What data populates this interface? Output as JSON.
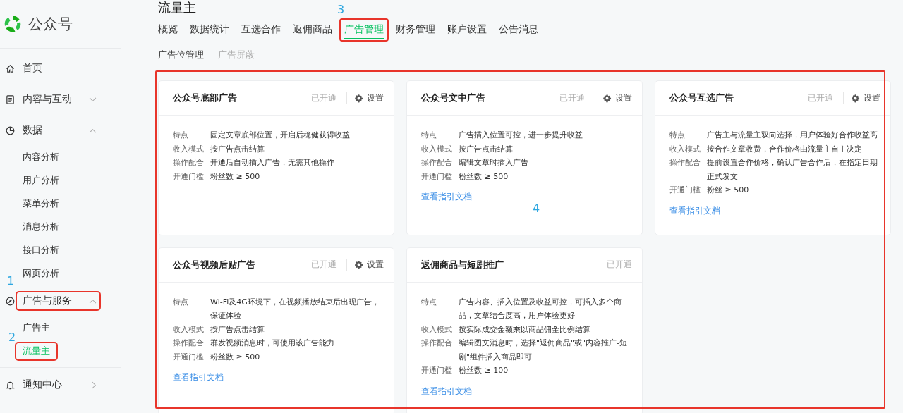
{
  "logo": {
    "text": "公众号"
  },
  "sidebar": {
    "items": [
      {
        "label": "首页",
        "kind": "plain"
      },
      {
        "label": "内容与互动",
        "kind": "group",
        "expanded": false
      },
      {
        "label": "数据",
        "kind": "group",
        "expanded": true,
        "children": [
          {
            "label": "内容分析",
            "selected": false
          },
          {
            "label": "用户分析",
            "selected": false
          },
          {
            "label": "菜单分析",
            "selected": false
          },
          {
            "label": "消息分析",
            "selected": false
          },
          {
            "label": "接口分析",
            "selected": false
          },
          {
            "label": "网页分析",
            "selected": false
          }
        ]
      },
      {
        "label": "广告与服务",
        "kind": "group",
        "expanded": true,
        "highlighted": true,
        "marker": "1",
        "children": [
          {
            "label": "广告主",
            "selected": false
          },
          {
            "label": "流量主",
            "selected": true,
            "highlighted": true,
            "marker": "2"
          }
        ]
      },
      {
        "label": "通知中心",
        "kind": "link"
      }
    ]
  },
  "page_title": "流量主",
  "tabs": [
    {
      "label": "概览",
      "selected": false
    },
    {
      "label": "数据统计",
      "selected": false
    },
    {
      "label": "互选合作",
      "selected": false
    },
    {
      "label": "返佣商品",
      "selected": false
    },
    {
      "label": "广告管理",
      "selected": true,
      "highlighted": true,
      "marker": "3"
    },
    {
      "label": "财务管理",
      "selected": false
    },
    {
      "label": "账户设置",
      "selected": false
    },
    {
      "label": "公告消息",
      "selected": false
    }
  ],
  "subtabs": [
    {
      "label": "广告位管理",
      "selected": true
    },
    {
      "label": "广告屏蔽",
      "selected": false
    }
  ],
  "ad_grid": {
    "highlighted": true,
    "marker": "4",
    "cards": [
      {
        "title": "公众号底部广告",
        "status": "已开通",
        "settings": "设置",
        "rows": [
          {
            "label": "特点",
            "value": "固定文章底部位置，开启后稳健获得收益"
          },
          {
            "label": "收入模式",
            "value": "按广告点击结算"
          },
          {
            "label": "操作配合",
            "value": "开通后自动插入广告，无需其他操作"
          },
          {
            "label": "开通门槛",
            "value": "粉丝数 ≥ 500"
          }
        ]
      },
      {
        "title": "公众号文中广告",
        "status": "已开通",
        "settings": "设置",
        "rows": [
          {
            "label": "特点",
            "value": "广告插入位置可控，进一步提升收益"
          },
          {
            "label": "收入模式",
            "value": "按广告点击结算"
          },
          {
            "label": "操作配合",
            "value": "编辑文章时插入广告"
          },
          {
            "label": "开通门槛",
            "value": "粉丝数 ≥ 500"
          }
        ],
        "link": "查看指引文档"
      },
      {
        "title": "公众号互选广告",
        "status": "已开通",
        "settings": "设置",
        "rows": [
          {
            "label": "特点",
            "value": "广告主与流量主双向选择，用户体验好合作收益高"
          },
          {
            "label": "收入模式",
            "value": "按合作文章收费，合作价格由流量主自主决定"
          },
          {
            "label": "操作配合",
            "value": "提前设置合作价格，确认广告合作后，在指定日期正式发文"
          },
          {
            "label": "开通门槛",
            "value": "粉丝 ≥ 500"
          }
        ],
        "link": "查看指引文档"
      },
      {
        "title": "公众号视频后贴广告",
        "status": "已开通",
        "settings": "设置",
        "rows": [
          {
            "label": "特点",
            "value": "Wi-Fi及4G环境下，在视频播放结束后出现广告，保证体验"
          },
          {
            "label": "收入模式",
            "value": "按广告点击结算"
          },
          {
            "label": "操作配合",
            "value": "群发视频消息时，可使用该广告能力"
          },
          {
            "label": "开通门槛",
            "value": "粉丝数 ≥ 500"
          }
        ],
        "link": "查看指引文档"
      },
      {
        "title": "返佣商品与短剧推广",
        "status": "已开通",
        "rows": [
          {
            "label": "特点",
            "value": "广告内容、插入位置及收益可控，可插入多个商品，文章结合度高，用户体验更好"
          },
          {
            "label": "收入模式",
            "value": "按实际成交金额乘以商品佣金比例结算"
          },
          {
            "label": "操作配合",
            "value": "编辑图文消息时，选择\"返佣商品\"或\"内容推广-短剧\"组件插入商品即可"
          },
          {
            "label": "开通门槛",
            "value": "粉丝数 ≥ 100"
          }
        ],
        "link": "查看指引文档"
      }
    ]
  }
}
